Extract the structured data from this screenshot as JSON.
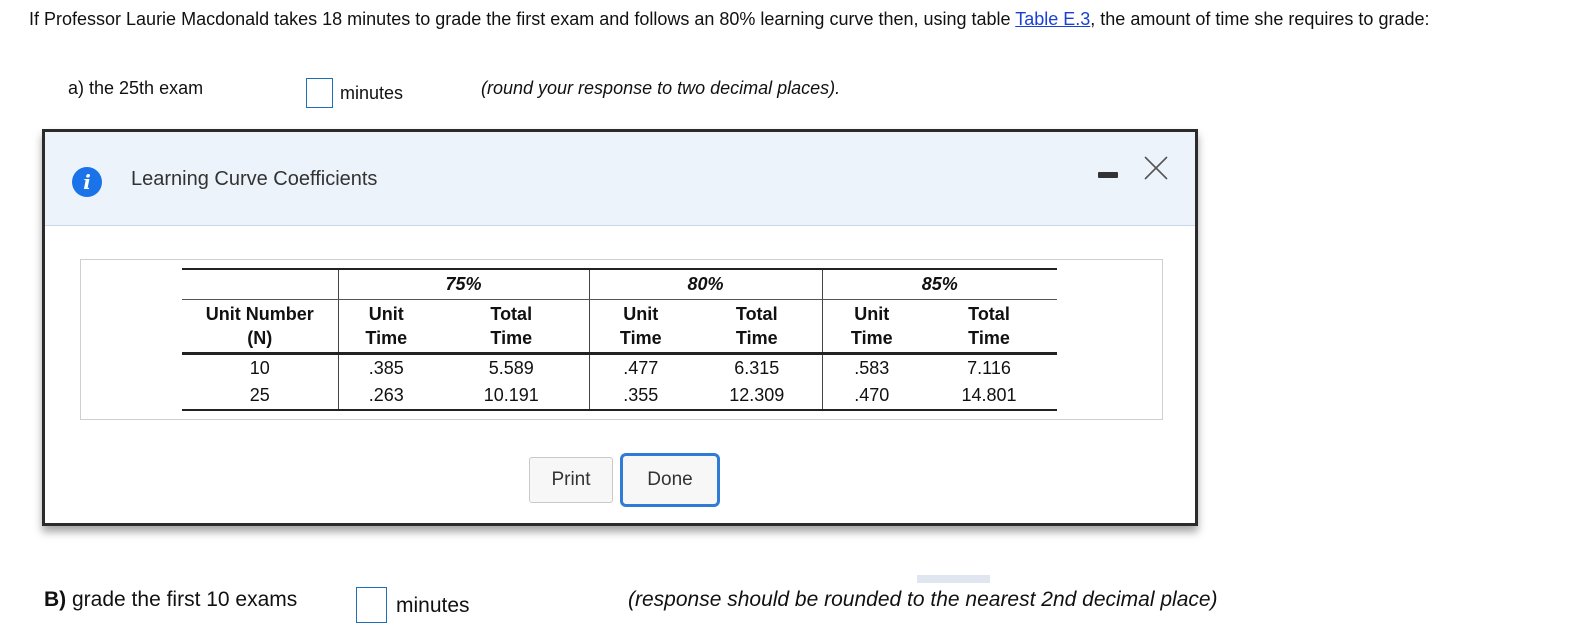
{
  "question": {
    "text_before": "If Professor Laurie Macdonald takes 18 minutes to grade the first exam and follows an 80% learning curve then, using table ",
    "link": "Table E.3",
    "text_after": ", the amount of time she requires to grade:"
  },
  "part_a": {
    "label": "a) the 25th exam",
    "value": "",
    "unit": "minutes",
    "hint": "(round your response to two decimal places)."
  },
  "part_b": {
    "label_bold": "B)",
    "label": " grade the first 10 exams",
    "value": "",
    "unit": "minutes",
    "hint": "(response should be rounded to the nearest 2nd decimal place)"
  },
  "modal": {
    "info_icon": "i",
    "title": "Learning Curve Coefficients",
    "minimize": "minimize-icon",
    "close": "close-icon",
    "print_label": "Print",
    "done_label": "Done"
  },
  "table": {
    "percent_headers": [
      "75%",
      "80%",
      "85%"
    ],
    "unit_number_header": [
      "Unit Number",
      "(N)"
    ],
    "unit_time_header": [
      "Unit",
      "Time"
    ],
    "total_time_header": [
      "Total",
      "Time"
    ],
    "rows": [
      {
        "n": "10",
        "u75": ".385",
        "t75": "5.589",
        "u80": ".477",
        "t80": "6.315",
        "u85": ".583",
        "t85": "7.116"
      },
      {
        "n": "25",
        "u75": ".263",
        "t75": "10.191",
        "u80": ".355",
        "t80": "12.309",
        "u85": ".470",
        "t85": "14.801"
      }
    ]
  },
  "colors": {
    "link": "#1a3fd6",
    "info_icon": "#1a73e8",
    "header_bg": "#edf3fa",
    "done_border": "#2f7bd6",
    "answer_box_border": "#1e6fb8"
  }
}
